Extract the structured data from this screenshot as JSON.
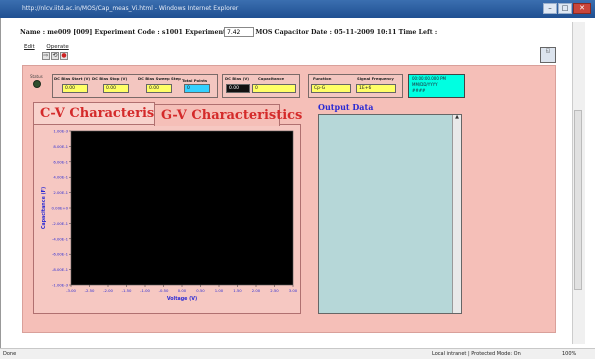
{
  "window": {
    "title": "http://nlcv.iitd.ac.in/MOS/Cap_meas_Vi.html - Windows Internet Explorer",
    "buttons": {
      "minimize": "–",
      "maximize": "□",
      "close": "✕"
    }
  },
  "header": {
    "text": "Name : me009 [009]    Experiment Code : s1001 Experiment Name : MOS Capacitor Date : 05-11-2009 10:11 Time Left :",
    "time_left": "7.42"
  },
  "menu": {
    "edit": "Edit",
    "operate": "Operate"
  },
  "toolbar": {
    "run": "⇨",
    "run_cont": "⟲",
    "stop": "●"
  },
  "status_led_label": "Status",
  "dc_bias_group": {
    "start_label": "DC Bias Start (V)",
    "stop_label": "DC Bias Stop (V)",
    "step_label": "DC Bias Sweep Step",
    "points_label": "Total Points",
    "start_value": "0.00",
    "stop_value": "0.00",
    "step_value": "0.00",
    "points_value": "0"
  },
  "meas_group": {
    "bias_label": "DC Bias (V)",
    "cap_label": "Capacitance",
    "bias_value": "0.00",
    "cap_value": "0"
  },
  "func_group": {
    "func_label": "Function",
    "freq_label": "Signal Frequency",
    "func_value": "Cp-G",
    "freq_value": "1E+6"
  },
  "datetime": {
    "time": "00:00:00.000 PM",
    "date": "MM/DD/YYYY",
    "extra": "####"
  },
  "tabs": {
    "cv": "C-V Characteristics",
    "gv": "G-V Characteristics"
  },
  "output": {
    "title": "Output Data"
  },
  "chart_data": {
    "type": "line",
    "title": "",
    "xlabel": "Voltage (V)",
    "ylabel": "Capacitance (F)",
    "x_ticks": [
      "-3.00",
      "-2.50",
      "-2.00",
      "-1.50",
      "-1.00",
      "-0.50",
      "0.00",
      "0.50",
      "1.00",
      "1.50",
      "2.00",
      "2.50",
      "3.00"
    ],
    "y_ticks": [
      "1.00E-3",
      "8.00E-1",
      "6.00E-1",
      "4.00E-1",
      "2.00E-1",
      "0.00E+0",
      "-2.00E-1",
      "-4.00E-1",
      "-6.00E-1",
      "-8.00E-1",
      "-1.00E-3"
    ],
    "xlim": [
      -3,
      3
    ],
    "series": []
  },
  "statusbar": {
    "left": "Done",
    "zone": "Local intranet | Protected Mode: On",
    "zoom": "100%"
  }
}
